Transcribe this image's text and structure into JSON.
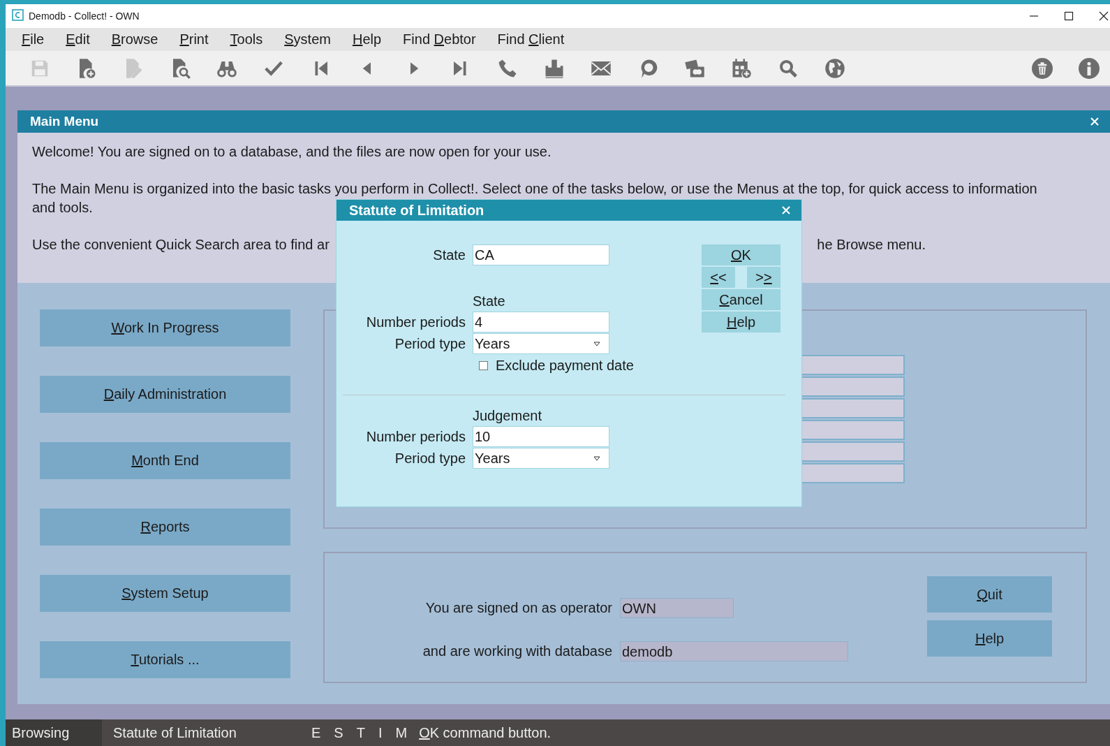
{
  "window": {
    "title": "Demodb - Collect! - OWN"
  },
  "menu": [
    {
      "key": "F",
      "post": "ile"
    },
    {
      "key": "E",
      "post": "dit"
    },
    {
      "key": "B",
      "post": "rowse"
    },
    {
      "key": "P",
      "post": "rint"
    },
    {
      "key": "T",
      "post": "ools"
    },
    {
      "key": "S",
      "post": "ystem"
    },
    {
      "key": "H",
      "post": "elp"
    },
    {
      "pre": "Find ",
      "key": "D",
      "post": "ebtor"
    },
    {
      "pre": "Find ",
      "key": "C",
      "post": "lient"
    }
  ],
  "toolbar": {
    "left": [
      {
        "kind": "save",
        "disabled": true
      },
      {
        "kind": "new",
        "disabled": false
      },
      {
        "kind": "edit",
        "disabled": true
      },
      {
        "kind": "find",
        "disabled": false
      },
      {
        "kind": "binoculars",
        "disabled": false
      },
      {
        "kind": "check",
        "disabled": false
      },
      {
        "kind": "first",
        "disabled": false
      },
      {
        "kind": "prev",
        "disabled": false
      },
      {
        "kind": "next",
        "disabled": false
      },
      {
        "kind": "last",
        "disabled": false
      },
      {
        "kind": "phone",
        "disabled": false
      },
      {
        "kind": "tray",
        "disabled": false
      },
      {
        "kind": "mail",
        "disabled": false
      },
      {
        "kind": "chat",
        "disabled": false
      },
      {
        "kind": "cards",
        "disabled": false
      },
      {
        "kind": "calendar",
        "disabled": false
      },
      {
        "kind": "search",
        "disabled": false
      },
      {
        "kind": "globe",
        "disabled": false
      }
    ],
    "right": [
      {
        "kind": "trash",
        "disabled": false
      },
      {
        "kind": "info",
        "disabled": false
      }
    ]
  },
  "main_menu": {
    "title": "Main Menu",
    "intro": [
      [
        "Welcome! You are signed on to a database, and the files are now open for your use."
      ],
      [
        "The Main Menu is organized into the basic tasks you perform in Collect!. Select one of the tasks below, or use the Menus at the top, for quick access to information",
        "and tools."
      ]
    ],
    "intro_cut": {
      "left": "Use the convenient Quick Search area to find ar",
      "right": "he Browse menu."
    },
    "tasks": [
      {
        "key": "W",
        "post": "ork In Progress"
      },
      {
        "key": "D",
        "post": "aily Administration"
      },
      {
        "key": "M",
        "post": "onth End"
      },
      {
        "key": "R",
        "post": "eports"
      },
      {
        "key": "S",
        "post": "ystem Setup"
      },
      {
        "key": "T",
        "post": "utorials ..."
      }
    ],
    "operator_label": "You are signed on as operator",
    "operator": "OWN",
    "database_label": "and are working with database",
    "database": "demodb",
    "buttons": [
      {
        "key": "Q",
        "post": "uit"
      },
      {
        "key": "H",
        "post": "elp"
      }
    ]
  },
  "dialog": {
    "title": "Statute of Limitation",
    "state_label": "State",
    "state": "CA",
    "sections": [
      {
        "heading": "State",
        "rows": [
          {
            "kind": "text",
            "label": "Number periods",
            "value": "4"
          },
          {
            "kind": "select",
            "label": "Period type",
            "value": "Years"
          }
        ],
        "checkbox": {
          "label": "Exclude payment date",
          "checked": false
        }
      },
      {
        "heading": "Judgement",
        "rows": [
          {
            "kind": "text",
            "label": "Number periods",
            "value": "10"
          },
          {
            "kind": "select",
            "label": "Period type",
            "value": "Years"
          }
        ]
      }
    ],
    "buttons": [
      {
        "kind": "wide",
        "label": {
          "key": "O",
          "post": "K"
        }
      },
      {
        "kind": "half",
        "label": {
          "key": "<",
          "post": "<"
        }
      },
      {
        "kind": "half",
        "label": {
          "pre": ">",
          "key": ">"
        }
      },
      {
        "kind": "wide",
        "label": {
          "key": "C",
          "post": "ancel"
        }
      },
      {
        "kind": "wide",
        "label": {
          "key": "H",
          "post": "elp"
        }
      }
    ]
  },
  "status_bar": {
    "mode": "Browsing",
    "screen": "Statute of Limitation",
    "flags": [
      "E",
      "S",
      "T",
      "I",
      "M"
    ],
    "hint": {
      "key": "O",
      "post": "K command button."
    }
  }
}
